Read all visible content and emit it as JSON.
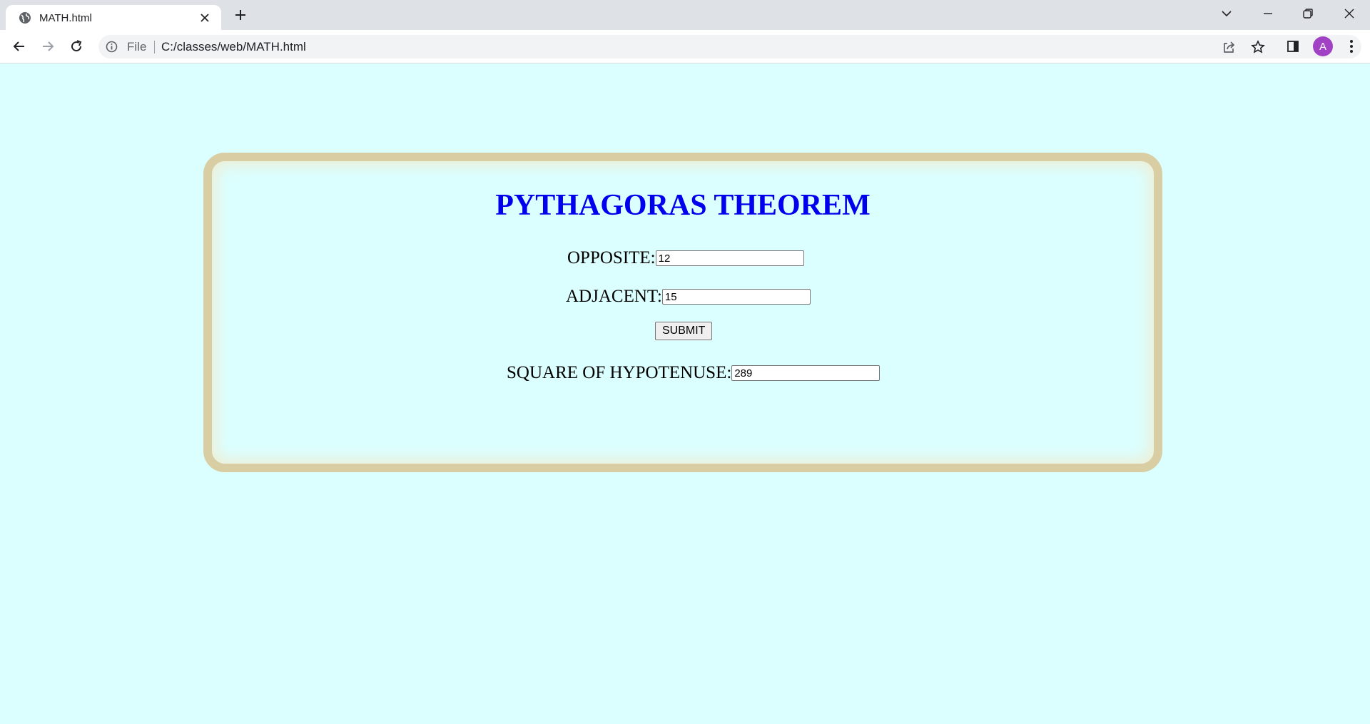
{
  "browser": {
    "tab_title": "MATH.html",
    "omnibox_scheme_label": "File",
    "url": "C:/classes/web/MATH.html",
    "profile_initial": "A",
    "profile_color": "#a142c4"
  },
  "page": {
    "background": "#dbfefe",
    "heading": "PYTHAGORAS THEOREM",
    "heading_color": "#0000ee",
    "border_color": "#d9cea3",
    "opposite": {
      "label": "OPPOSITE:",
      "value": "12"
    },
    "adjacent": {
      "label": "ADJACENT:",
      "value": "15"
    },
    "submit_label": "SUBMIT",
    "hypotenuse": {
      "label": "SQUARE OF HYPOTENUSE:",
      "value": "289"
    }
  }
}
